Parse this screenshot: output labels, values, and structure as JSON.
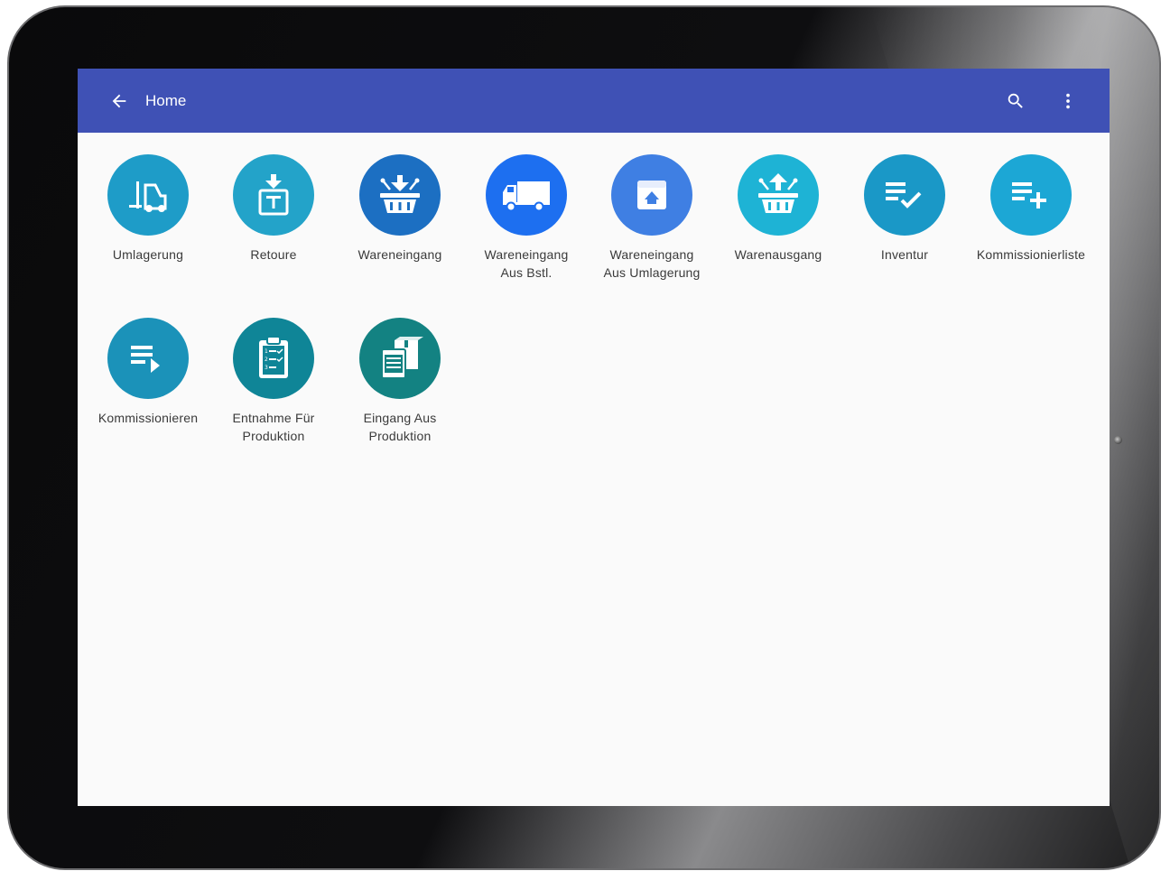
{
  "appbar": {
    "title": "Home",
    "back_icon": "arrow-left-icon",
    "search_icon": "search-icon",
    "more_icon": "more-vert-icon",
    "color": "#3f51b5"
  },
  "tiles": [
    {
      "label": "Umlagerung",
      "icon": "forklift-icon",
      "color": "#1e9cc8"
    },
    {
      "label": "Retoure",
      "icon": "return-box-icon",
      "color": "#23a3c9"
    },
    {
      "label": "Wareneingang",
      "icon": "basket-in-icon",
      "color": "#1c6fc2"
    },
    {
      "label": "Wareneingang\nAus Bstl.",
      "icon": "truck-icon",
      "color": "#1d6ff0"
    },
    {
      "label": "Wareneingang\nAus Umlagerung",
      "icon": "archive-up-icon",
      "color": "#3f7fe3"
    },
    {
      "label": "Warenausgang",
      "icon": "basket-out-icon",
      "color": "#1eb3d5"
    },
    {
      "label": "Inventur",
      "icon": "list-check-icon",
      "color": "#1a98c7"
    },
    {
      "label": "Kommissionierliste",
      "icon": "list-plus-icon",
      "color": "#1ca7d5"
    },
    {
      "label": "Kommissionieren",
      "icon": "list-play-icon",
      "color": "#1b92b9"
    },
    {
      "label": "Entnahme Für\nProduktion",
      "icon": "clipboard-checklist-icon",
      "color": "#0f8597"
    },
    {
      "label": "Eingang Aus\nProduktion",
      "icon": "production-box-icon",
      "color": "#138282"
    }
  ]
}
